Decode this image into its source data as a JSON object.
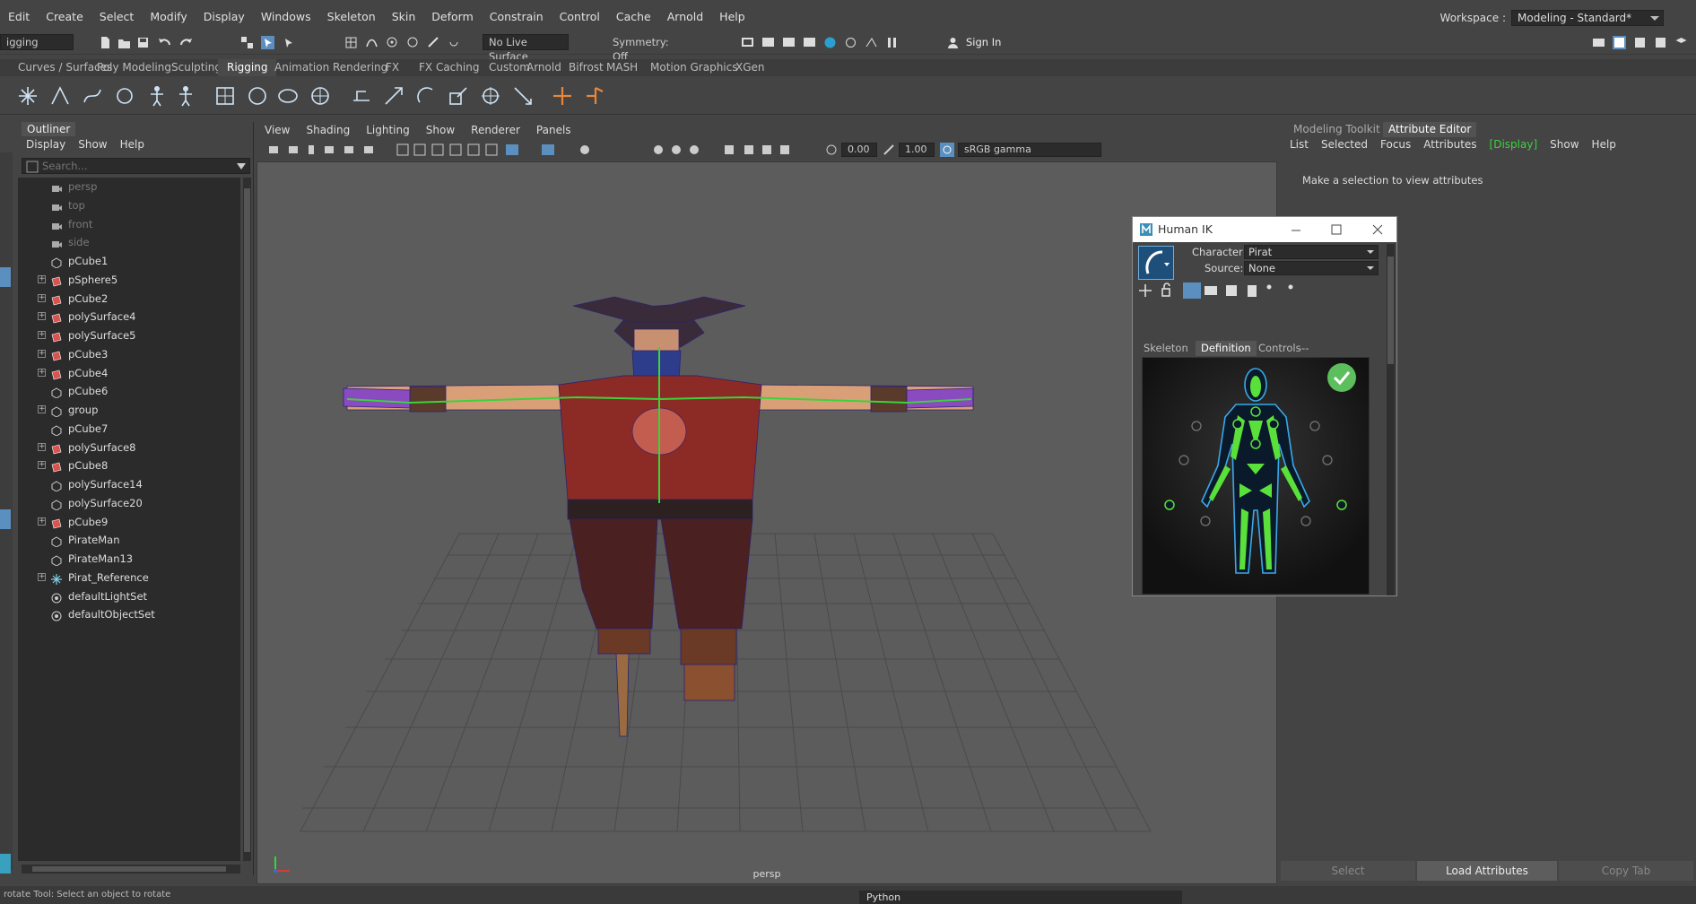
{
  "menubar": {
    "items": [
      "Edit",
      "Create",
      "Select",
      "Modify",
      "Display",
      "Windows",
      "Skeleton",
      "Skin",
      "Deform",
      "Constrain",
      "Control",
      "Cache",
      "Arnold",
      "Help"
    ]
  },
  "workspace": {
    "label": "Workspace :",
    "value": "Modeling - Standard*"
  },
  "status_line": {
    "menu_set": "igging",
    "live_surface": "No Live Surface",
    "symmetry": "Symmetry: Off",
    "sign_in": "Sign In"
  },
  "shelf": {
    "tabs": [
      "Curves / Surfaces",
      "Poly Modeling",
      "Sculpting",
      "Rigging",
      "Animation",
      "Rendering",
      "FX",
      "FX Caching",
      "Custom",
      "Arnold",
      "Bifrost",
      "MASH",
      "Motion Graphics",
      "XGen"
    ],
    "active_tab": "Rigging"
  },
  "outliner": {
    "title": "Outliner",
    "menu": [
      "Display",
      "Show",
      "Help"
    ],
    "search_placeholder": "Search...",
    "items": [
      {
        "label": "persp",
        "icon": "camera-icon",
        "expandable": false,
        "dim": true
      },
      {
        "label": "top",
        "icon": "camera-icon",
        "expandable": false,
        "dim": true
      },
      {
        "label": "front",
        "icon": "camera-icon",
        "expandable": false,
        "dim": true
      },
      {
        "label": "side",
        "icon": "camera-icon",
        "expandable": false,
        "dim": true
      },
      {
        "label": "pCube1",
        "icon": "transform-icon",
        "expandable": false,
        "dim": false
      },
      {
        "label": "pSphere5",
        "icon": "mesh-icon",
        "expandable": true,
        "dim": false
      },
      {
        "label": "pCube2",
        "icon": "mesh-icon",
        "expandable": true,
        "dim": false
      },
      {
        "label": "polySurface4",
        "icon": "mesh-icon",
        "expandable": true,
        "dim": false
      },
      {
        "label": "polySurface5",
        "icon": "mesh-icon",
        "expandable": true,
        "dim": false
      },
      {
        "label": "pCube3",
        "icon": "mesh-icon",
        "expandable": true,
        "dim": false
      },
      {
        "label": "pCube4",
        "icon": "mesh-icon",
        "expandable": true,
        "dim": false
      },
      {
        "label": "pCube6",
        "icon": "transform-icon",
        "expandable": false,
        "dim": false
      },
      {
        "label": "group",
        "icon": "transform-icon",
        "expandable": true,
        "dim": false
      },
      {
        "label": "pCube7",
        "icon": "transform-icon",
        "expandable": false,
        "dim": false
      },
      {
        "label": "polySurface8",
        "icon": "mesh-icon",
        "expandable": true,
        "dim": false
      },
      {
        "label": "pCube8",
        "icon": "mesh-icon",
        "expandable": true,
        "dim": false
      },
      {
        "label": "polySurface14",
        "icon": "transform-icon",
        "expandable": false,
        "dim": false
      },
      {
        "label": "polySurface20",
        "icon": "transform-icon",
        "expandable": false,
        "dim": false
      },
      {
        "label": "pCube9",
        "icon": "mesh-icon",
        "expandable": true,
        "dim": false
      },
      {
        "label": "PirateMan",
        "icon": "transform-icon",
        "expandable": false,
        "dim": false
      },
      {
        "label": "PirateMan13",
        "icon": "transform-icon",
        "expandable": false,
        "dim": false
      },
      {
        "label": "Pirat_Reference",
        "icon": "joint-icon",
        "expandable": true,
        "dim": false
      },
      {
        "label": "defaultLightSet",
        "icon": "set-icon",
        "expandable": false,
        "dim": false
      },
      {
        "label": "defaultObjectSet",
        "icon": "set-icon",
        "expandable": false,
        "dim": false
      }
    ]
  },
  "viewport": {
    "menu": [
      "View",
      "Shading",
      "Lighting",
      "Show",
      "Renderer",
      "Panels"
    ],
    "exposure": "0.00",
    "gamma": "1.00",
    "color_space": "sRGB gamma",
    "camera_label": "persp"
  },
  "attribute_editor": {
    "tabs": [
      "Modeling Toolkit",
      "Attribute Editor"
    ],
    "active_tab": "Attribute Editor",
    "menu": [
      "List",
      "Selected",
      "Focus",
      "Attributes",
      "[Display]",
      "Show",
      "Help"
    ],
    "empty_message": "Make a selection to view attributes",
    "buttons": [
      "Select",
      "Load Attributes",
      "Copy Tab"
    ]
  },
  "human_ik": {
    "title": "Human IK",
    "character_label": "Character:",
    "character_value": "Pirat",
    "source_label": "Source:",
    "source_value": "None",
    "tabs": [
      "Skeleton",
      "Definition",
      "Controls",
      "---"
    ],
    "active_tab": "Definition"
  },
  "bottom": {
    "help_line": "rotate Tool: Select an object to rotate",
    "script_tab": "Python"
  },
  "colors": {
    "accent": "#5aa0d8",
    "highlight_green": "#3cd23c",
    "check_green": "#5cbe5c",
    "maya_bg": "#444444"
  }
}
